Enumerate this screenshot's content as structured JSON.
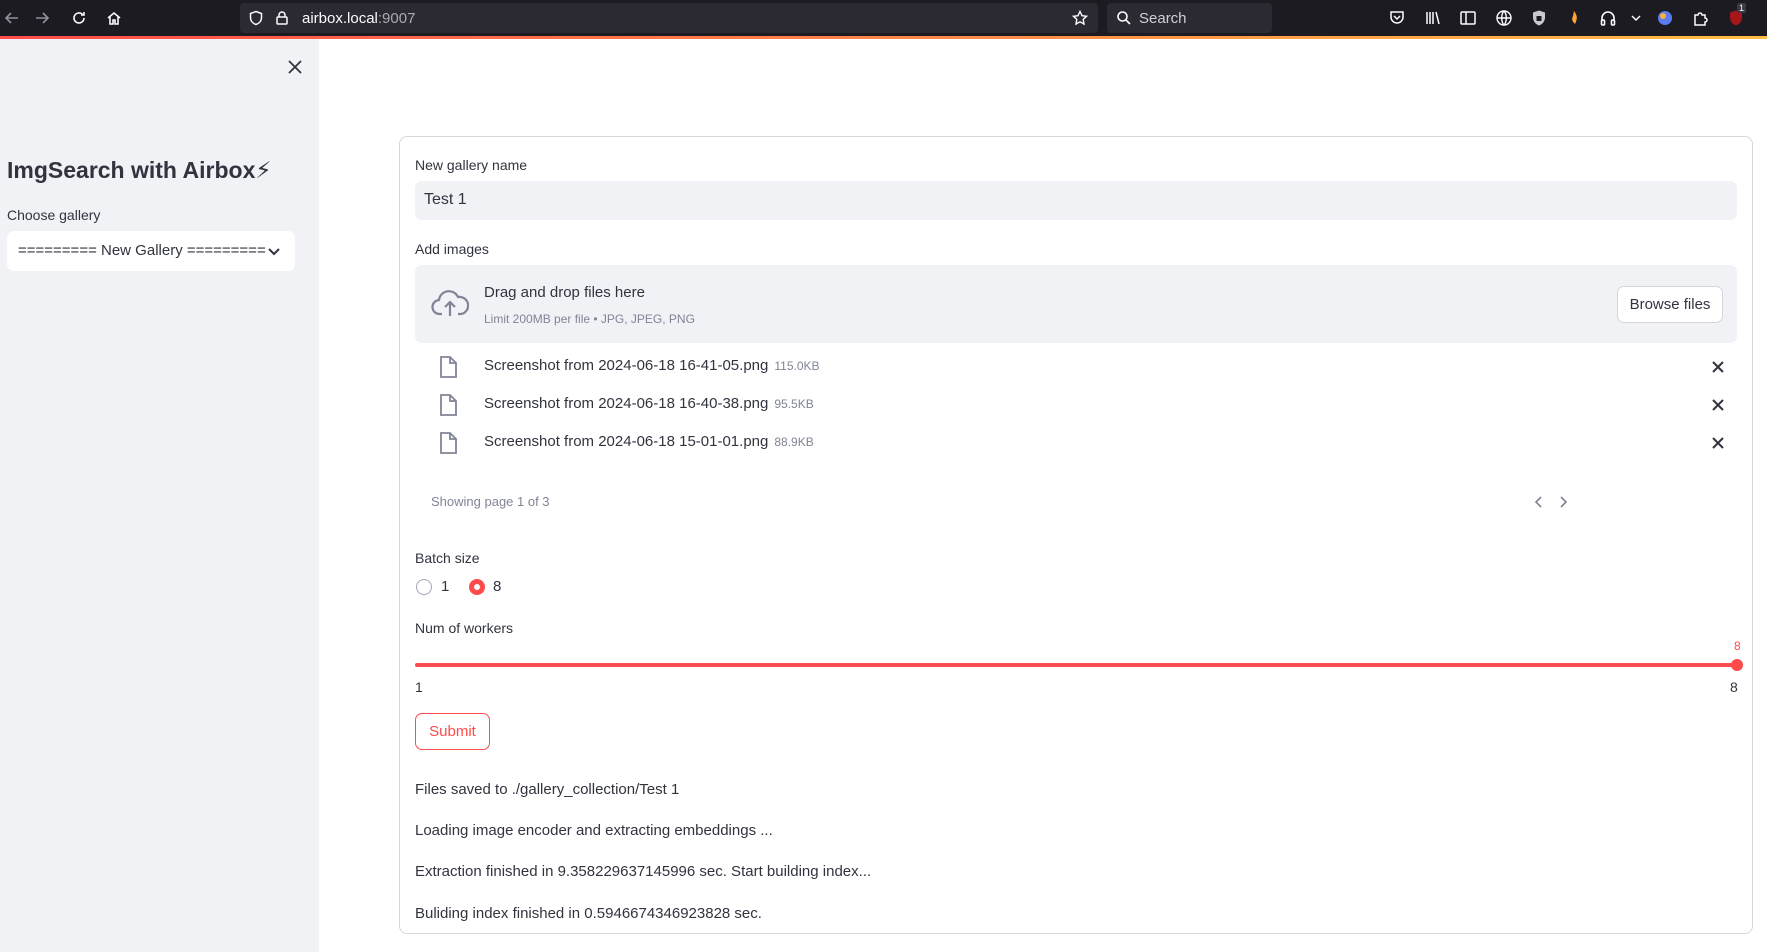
{
  "browser": {
    "url_host": "airbox.local",
    "url_port": ":9007",
    "search_placeholder": "Search",
    "notification_badge": "1"
  },
  "sidebar": {
    "title": "ImgSearch with Airbox⚡",
    "choose_gallery_label": "Choose gallery",
    "selected_gallery": "========= New Gallery ========="
  },
  "form": {
    "gallery_name_label": "New gallery name",
    "gallery_name_value": "Test 1",
    "add_images_label": "Add images",
    "dropzone_title": "Drag and drop files here",
    "dropzone_limit": "Limit 200MB per file • JPG, JPEG, PNG",
    "browse_label": "Browse files",
    "files": [
      {
        "name": "Screenshot from 2024-06-18 16-41-05.png",
        "size": "115.0KB"
      },
      {
        "name": "Screenshot from 2024-06-18 16-40-38.png",
        "size": "95.5KB"
      },
      {
        "name": "Screenshot from 2024-06-18 15-01-01.png",
        "size": "88.9KB"
      }
    ],
    "pager_text": "Showing page 1 of 3",
    "batch_size_label": "Batch size",
    "batch_options": [
      "1",
      "8"
    ],
    "batch_selected": "8",
    "workers_label": "Num of workers",
    "workers_value": "8",
    "workers_min": "1",
    "workers_max": "8",
    "submit_label": "Submit"
  },
  "status": {
    "lines": [
      "Files saved to ./gallery_collection/Test 1",
      "Loading image encoder and extracting embeddings ...",
      "Extraction finished in 9.358229637145996 sec. Start building index...",
      "Buliding index finished in 0.5946674346923828 sec."
    ]
  },
  "colors": {
    "accent": "#ff4b4b",
    "sidebar_bg": "#f0f2f6",
    "text": "#31333f",
    "muted": "#808495",
    "browser_bg": "#1c1b22"
  }
}
